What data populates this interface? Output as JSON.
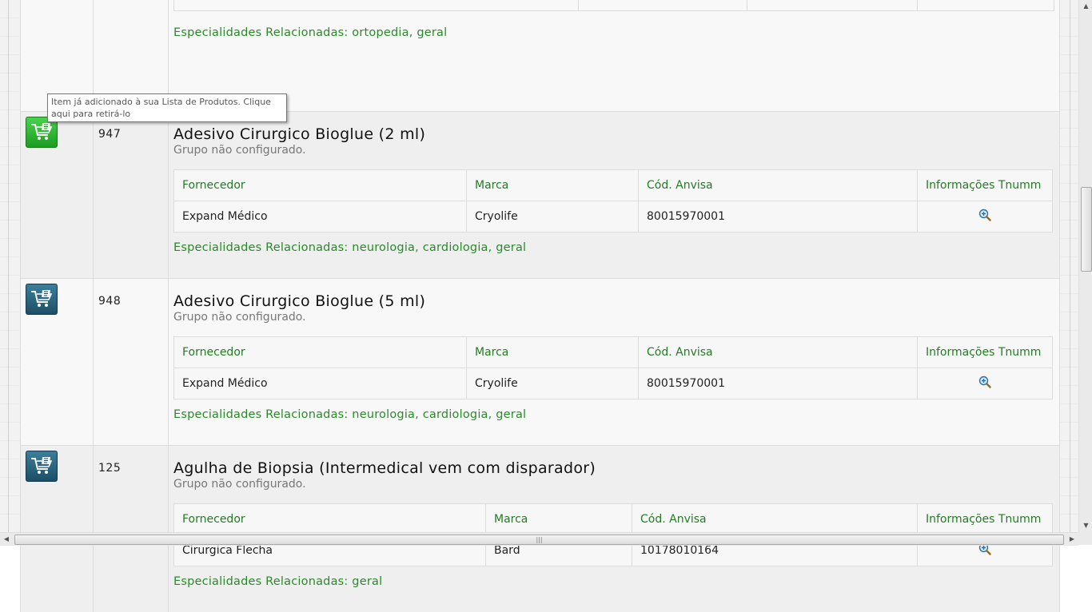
{
  "tooltip": {
    "text": "Item já adicionado à sua Lista de Produtos. Clique aqui para retirá-lo"
  },
  "top_partial": {
    "specialties": "Especialidades Relacionadas: ortopedia, geral"
  },
  "products": [
    {
      "code": "947",
      "name": "Adesivo Cirurgico Bioglue (2 ml)",
      "group": "Grupo não configurado.",
      "added": true,
      "headers": {
        "supplier": "Fornecedor",
        "brand": "Marca",
        "anvisa": "Cód. Anvisa",
        "info": "Informações Tnumm"
      },
      "supplier": "Expand Médico",
      "brand": "Cryolife",
      "anvisa": "80015970001",
      "specialties": "Especialidades Relacionadas: neurologia, cardiologia, geral"
    },
    {
      "code": "948",
      "name": "Adesivo Cirurgico Bioglue (5 ml)",
      "group": "Grupo não configurado.",
      "added": false,
      "headers": {
        "supplier": "Fornecedor",
        "brand": "Marca",
        "anvisa": "Cód. Anvisa",
        "info": "Informações Tnumm"
      },
      "supplier": "Expand Médico",
      "brand": "Cryolife",
      "anvisa": "80015970001",
      "specialties": "Especialidades Relacionadas: neurologia, cardiologia, geral"
    },
    {
      "code": "125",
      "name": "Agulha de Biopsia (Intermedical vem com disparador)",
      "group": "Grupo não configurado.",
      "added": false,
      "headers": {
        "supplier": "Fornecedor",
        "brand": "Marca",
        "anvisa": "Cód. Anvisa",
        "info": "Informações Tnumm"
      },
      "supplier": "Cirurgica Flecha",
      "brand": "Bard",
      "anvisa": "10178010164",
      "specialties": "Especialidades Relacionadas: geral"
    }
  ],
  "icons": {
    "cart": "cart-icon",
    "zoom": "zoom-in-icon"
  },
  "colors": {
    "green_text": "#2a8a2a",
    "cart_blue": "#1c4f66",
    "cart_green": "#1c9d21"
  }
}
